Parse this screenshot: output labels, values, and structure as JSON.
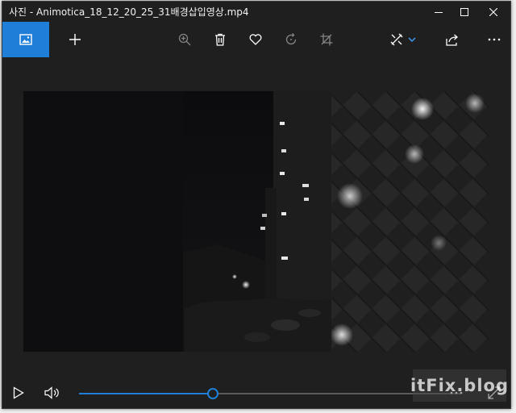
{
  "window": {
    "title": "사진 - Animotica_18_12_20_25_31배경삽입영상.mp4",
    "controls": [
      "minimize-icon",
      "maximize-icon",
      "close-icon"
    ]
  },
  "toolbar": {
    "left": [
      {
        "name": "see-all-photos-button",
        "icon": "photo-icon",
        "active": true
      },
      {
        "name": "add-to-button",
        "icon": "plus-icon"
      }
    ],
    "center": [
      {
        "name": "zoom-button",
        "icon": "zoom-icon",
        "disabled": true
      },
      {
        "name": "delete-button",
        "icon": "trash-icon"
      },
      {
        "name": "favorite-button",
        "icon": "heart-icon"
      },
      {
        "name": "rotate-button",
        "icon": "rotate-icon",
        "disabled": true
      },
      {
        "name": "crop-button",
        "icon": "crop-icon",
        "disabled": true
      }
    ],
    "right": [
      {
        "name": "edit-create-button",
        "icon": "edit-tools-icon"
      },
      {
        "name": "share-button",
        "icon": "share-icon"
      },
      {
        "name": "more-button",
        "icon": "more-icon"
      }
    ]
  },
  "player": {
    "progress": 0.35,
    "controls": [
      "play-icon",
      "volume-icon",
      "more-icon",
      "fullscreen-icon"
    ]
  },
  "watermark": {
    "text": "itFix.blog"
  },
  "colors": {
    "accent": "#1f7fd8",
    "background": "#1f1f1f",
    "text": "#ffffff"
  }
}
